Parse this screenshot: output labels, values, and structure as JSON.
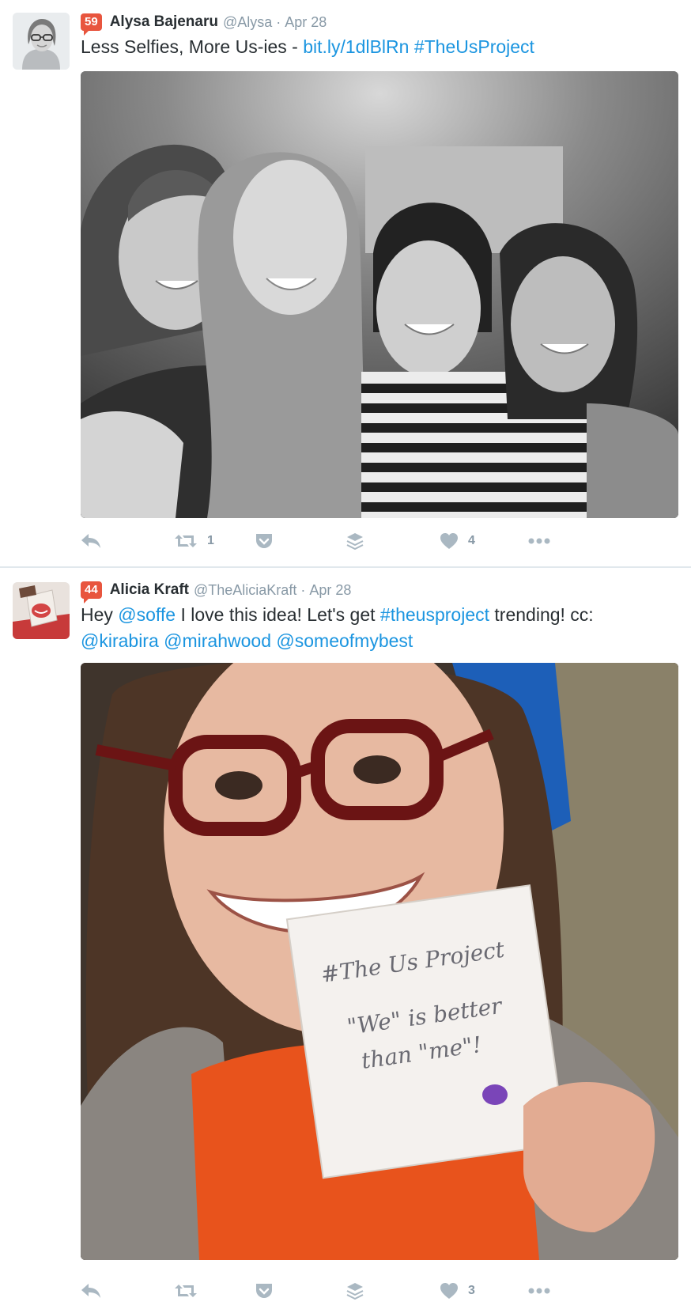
{
  "tweets": [
    {
      "badge": "59",
      "badge_color": "#e8553e",
      "name": "Alysa Bajenaru",
      "handle": "@Alysa",
      "separator": "·",
      "date": "Apr 28",
      "text_parts": [
        {
          "text": "Less Selfies, More Us-ies - ",
          "link": false
        },
        {
          "text": "bit.ly/1dlBlRn",
          "link": true
        },
        {
          "text": " ",
          "link": false
        },
        {
          "text": "#TheUsProject",
          "link": true
        }
      ],
      "photo_description_icon": "photo-icon",
      "actions": {
        "reply_icon": "reply-icon",
        "retweet_icon": "retweet-icon",
        "retweet_count": "1",
        "pocket_icon": "pocket-icon",
        "buffer_icon": "buffer-icon",
        "like_icon": "heart-icon",
        "like_count": "4",
        "more_icon": "more-icon"
      }
    },
    {
      "badge": "44",
      "badge_color": "#e8553e",
      "name": "Alicia Kraft",
      "handle": "@TheAliciaKraft",
      "separator": "·",
      "date": "Apr 28",
      "text_parts": [
        {
          "text": "Hey ",
          "link": false
        },
        {
          "text": "@soffe",
          "link": true
        },
        {
          "text": " I love this idea! Let's get ",
          "link": false
        },
        {
          "text": "#theusproject",
          "link": true
        },
        {
          "text": " trending! cc: ",
          "link": false
        },
        {
          "text": "@kirabira",
          "link": true
        },
        {
          "text": " ",
          "link": false
        },
        {
          "text": "@mirahwood",
          "link": true
        },
        {
          "text": " ",
          "link": false
        },
        {
          "text": "@someofmybest",
          "link": true
        }
      ],
      "note_line1": "#The Us Project",
      "note_line2": "\"We\" is better",
      "note_line3": "than \"me\"!",
      "actions": {
        "reply_icon": "reply-icon",
        "retweet_icon": "retweet-icon",
        "retweet_count": "",
        "pocket_icon": "pocket-icon",
        "buffer_icon": "buffer-icon",
        "like_icon": "heart-icon",
        "like_count": "3",
        "more_icon": "more-icon"
      }
    }
  ],
  "colors": {
    "link": "#1b95e0",
    "icon": "#aab8c2",
    "muted_text": "#8899a6"
  }
}
